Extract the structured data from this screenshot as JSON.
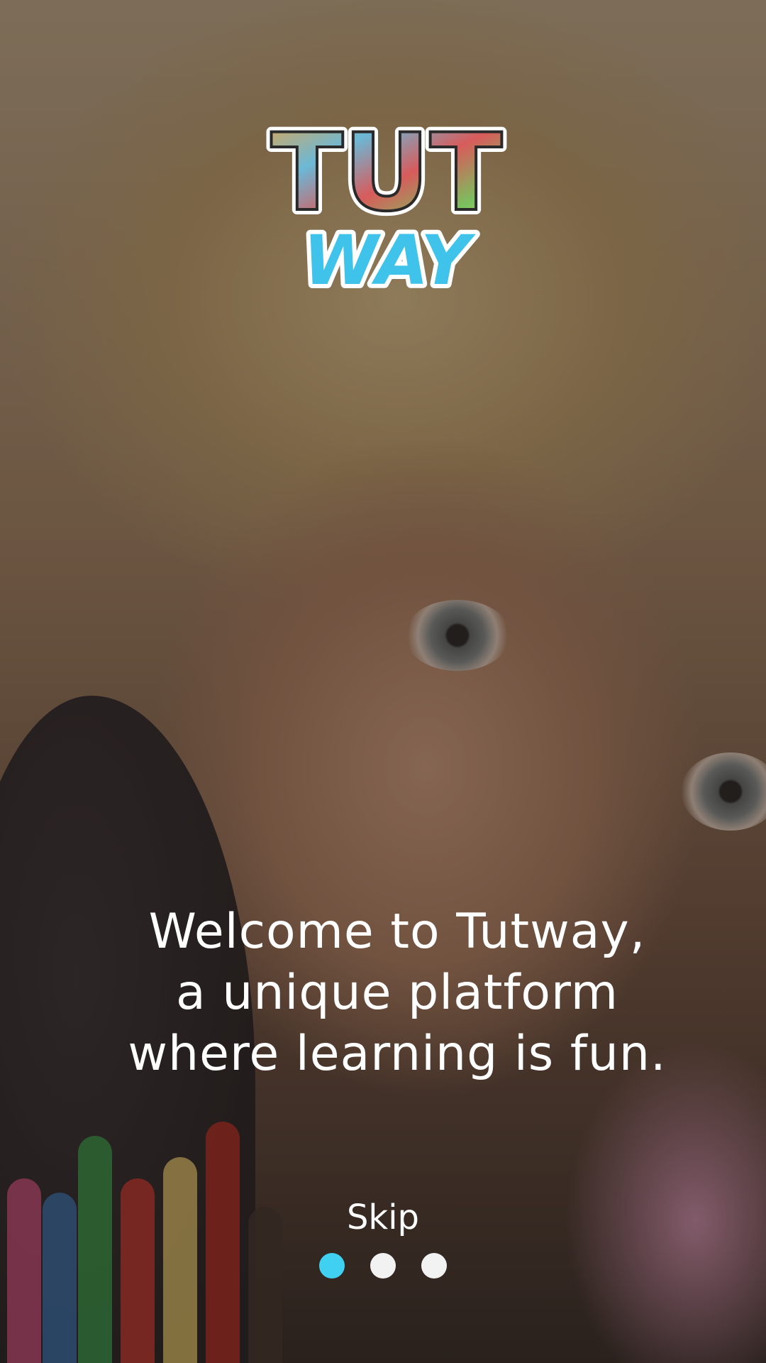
{
  "logo": {
    "top_text": "TUT",
    "bottom_text": "WAY"
  },
  "welcome": {
    "lines": [
      "Welcome to Tutway,",
      "a unique platform",
      "where learning is fun."
    ]
  },
  "skip_label": "Skip",
  "pagination": {
    "total": 3,
    "active_index": 0
  },
  "colors": {
    "accent": "#3fd0f2",
    "dot_inactive": "#f2f2f2",
    "text": "#ffffff"
  }
}
